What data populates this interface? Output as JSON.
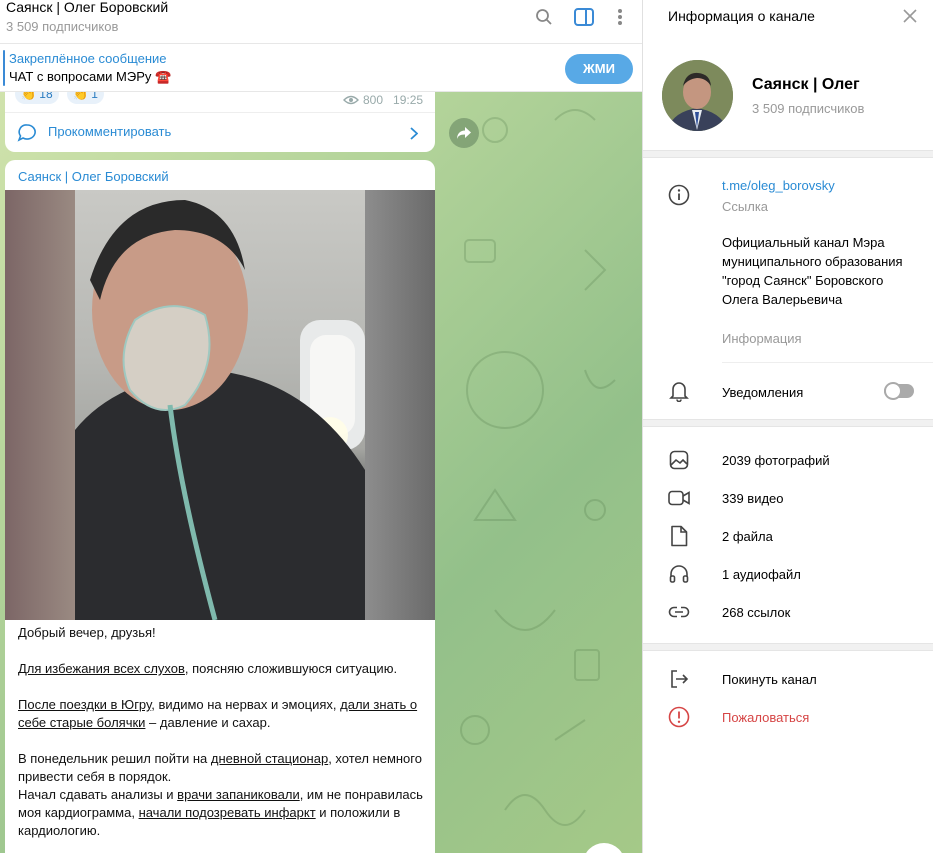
{
  "chat": {
    "title": "Саянск | Олег Боровский",
    "subscribers": "3 509 подписчиков",
    "pinned": {
      "title": "Закреплённое сообщение",
      "text": "ЧАТ с вопросами МЭРу ☎️",
      "button": "ЖМИ"
    },
    "prev_message": {
      "reactions": [
        {
          "emoji": "👏",
          "count": "18"
        },
        {
          "emoji": "👏",
          "count": "1"
        }
      ],
      "views": "800",
      "time": "19:25",
      "comment_label": "Прокомментировать"
    },
    "post": {
      "author": "Саянск | Олег Боровский",
      "p1": "Добрый вечер, друзья!",
      "p2_link": "Для избежания всех слухов",
      "p2_rest": ", поясняю сложившуюся ситуацию.",
      "p3_link1": "После поездки в Югру",
      "p3_mid": ", видимо на нервах и эмоциях, ",
      "p3_link2": "дали знать о себе старые болячки",
      "p3_rest": " – давление и сахар.",
      "p4_a": "В понедельник решил пойти на ",
      "p4_link": "дневной стационар",
      "p4_b": ", хотел немного привести себя в порядок.",
      "p5_a": "Начал сдавать анализы и ",
      "p5_link1": "врачи запаниковали",
      "p5_b": ", им не понравилась моя кардиограмма, ",
      "p5_link2": "начали подозревать инфаркт",
      "p5_c": " и положили в кардиологию."
    }
  },
  "panel": {
    "title": "Информация о канале",
    "name": "Саянск | Олег",
    "subscribers": "3 509 подписчиков",
    "link": "t.me/oleg_borovsky",
    "link_label": "Ссылка",
    "description": "Официальный канал Мэра муниципального образования \"город Саянск\" Боровского Олега Валерьевича",
    "description_label": "Информация",
    "notifications": "Уведомления",
    "media": {
      "photos": "2039 фотографий",
      "videos": "339 видео",
      "files": "2 файла",
      "audio": "1 аудиофайл",
      "links": "268 ссылок"
    },
    "leave": "Покинуть канал",
    "report": "Пожаловаться"
  },
  "colors": {
    "accent": "#2a8bd4",
    "button": "#58a9e6",
    "danger": "#d64545"
  }
}
